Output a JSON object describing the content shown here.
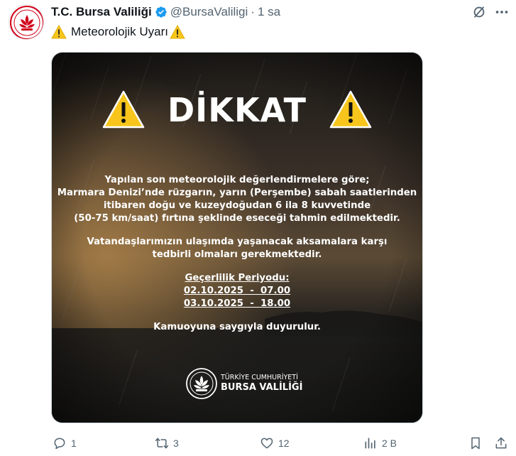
{
  "account": {
    "name": "T.C. Bursa Valiliği",
    "handle": "@BursaValiligi",
    "time": "1 sa"
  },
  "tweet": {
    "text": "Meteorolojik Uyarı"
  },
  "poster": {
    "title": "DİKKAT",
    "paragraph1": [
      "Yapılan son meteorolojik değerlendirmelere göre;",
      "Marmara Denizi’nde rüzgarın, yarın (Perşembe) sabah saatlerinden",
      "itibaren doğu ve kuzeydoğudan 6 ila 8 kuvvetinde",
      "(50-75 km/saat) fırtına şeklinde eseceği tahmin edilmektedir."
    ],
    "paragraph2": [
      "Vatandaşlarımızın ulaşımda yaşanacak aksamalara karşı",
      "tedbirli olmaları gerekmektedir."
    ],
    "validity_title": "Geçerlilik Periyodu:",
    "validity_from": "02.10.2025  -  07.00",
    "validity_to": "03.10.2025  -  18.00",
    "closing": "Kamuoyuna saygıyla duyurulur.",
    "logo_line1": "TÜRKİYE CUMHURİYETİ",
    "logo_line2": "BURSA VALİLİĞİ"
  },
  "actions": {
    "replies": "1",
    "reposts": "3",
    "likes": "12",
    "views": "2 B"
  },
  "colors": {
    "verified": "#1d9bf0",
    "warning": "#f7c51b",
    "logo_red": "#d0021b",
    "muted": "#536471"
  },
  "icons": [
    "verified-badge-icon",
    "mute-icon",
    "more-icon",
    "warning-icon",
    "reply-icon",
    "repost-icon",
    "like-icon",
    "views-icon",
    "bookmark-icon",
    "share-icon"
  ]
}
